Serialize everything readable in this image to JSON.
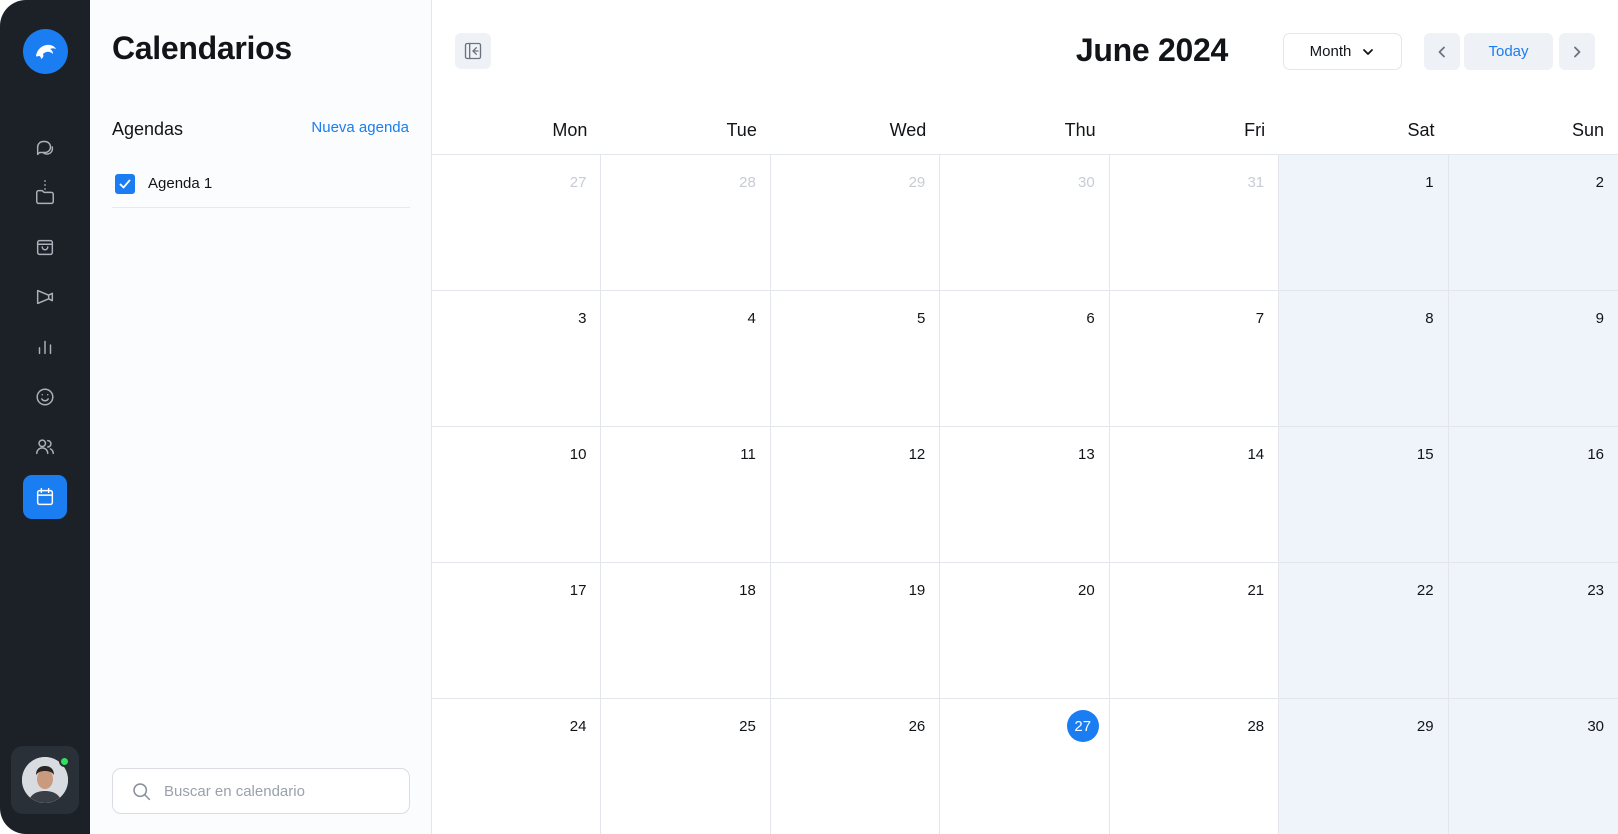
{
  "colors": {
    "accent": "#1a7df1",
    "rail_bg": "#1c2127",
    "weekend_bg": "#eff3fa",
    "online": "#2ee35a"
  },
  "rail": {
    "items": [
      {
        "name": "chat-icon"
      },
      {
        "name": "folder-icon"
      },
      {
        "name": "shopping-bag-icon"
      },
      {
        "name": "megaphone-icon"
      },
      {
        "name": "bar-chart-icon"
      },
      {
        "name": "smile-icon"
      },
      {
        "name": "users-icon"
      },
      {
        "name": "calendar-icon",
        "active": true
      }
    ]
  },
  "panel": {
    "title": "Calendarios",
    "section_label": "Agendas",
    "new_agenda_label": "Nueva agenda",
    "agendas": [
      {
        "label": "Agenda 1",
        "checked": true
      }
    ],
    "search_placeholder": "Buscar en calendario"
  },
  "header": {
    "month_title": "June 2024",
    "view_label": "Month",
    "today_label": "Today"
  },
  "weekdays": [
    "Mon",
    "Tue",
    "Wed",
    "Thu",
    "Fri",
    "Sat",
    "Sun"
  ],
  "weeks": [
    [
      {
        "d": "27",
        "o": true
      },
      {
        "d": "28",
        "o": true
      },
      {
        "d": "29",
        "o": true
      },
      {
        "d": "30",
        "o": true
      },
      {
        "d": "31",
        "o": true
      },
      {
        "d": "1"
      },
      {
        "d": "2"
      }
    ],
    [
      {
        "d": "3"
      },
      {
        "d": "4"
      },
      {
        "d": "5"
      },
      {
        "d": "6"
      },
      {
        "d": "7"
      },
      {
        "d": "8"
      },
      {
        "d": "9"
      }
    ],
    [
      {
        "d": "10"
      },
      {
        "d": "11"
      },
      {
        "d": "12"
      },
      {
        "d": "13"
      },
      {
        "d": "14"
      },
      {
        "d": "15"
      },
      {
        "d": "16"
      }
    ],
    [
      {
        "d": "17"
      },
      {
        "d": "18"
      },
      {
        "d": "19"
      },
      {
        "d": "20"
      },
      {
        "d": "21"
      },
      {
        "d": "22"
      },
      {
        "d": "23"
      }
    ],
    [
      {
        "d": "24"
      },
      {
        "d": "25"
      },
      {
        "d": "26"
      },
      {
        "d": "27",
        "today": true
      },
      {
        "d": "28"
      },
      {
        "d": "29"
      },
      {
        "d": "30"
      }
    ]
  ]
}
